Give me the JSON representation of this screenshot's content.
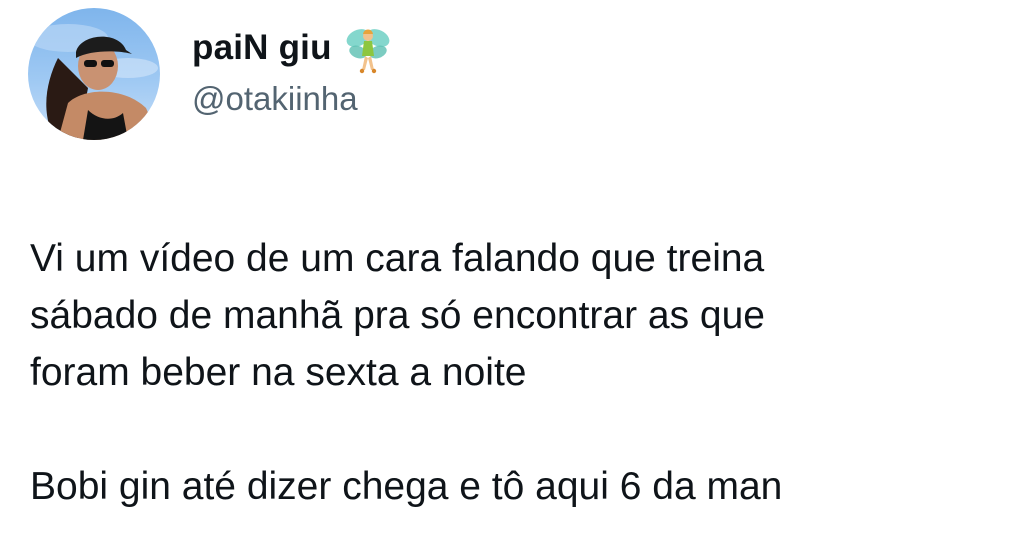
{
  "author": {
    "display_name": "paiN giu",
    "display_emoji": "fairy-emoji",
    "handle": "@otakiinha",
    "avatar": "profile-photo"
  },
  "tweet": {
    "lines": [
      "Vi um vídeo de um cara falando que treina",
      "sábado de manhã pra só encontrar as que",
      "foram beber na sexta a noite"
    ],
    "cut_off_line": "Bobi gin até dizer chega e tô aqui 6 da man"
  },
  "colors": {
    "text": "#0f1419",
    "secondary_text": "#536471",
    "background": "#ffffff"
  }
}
